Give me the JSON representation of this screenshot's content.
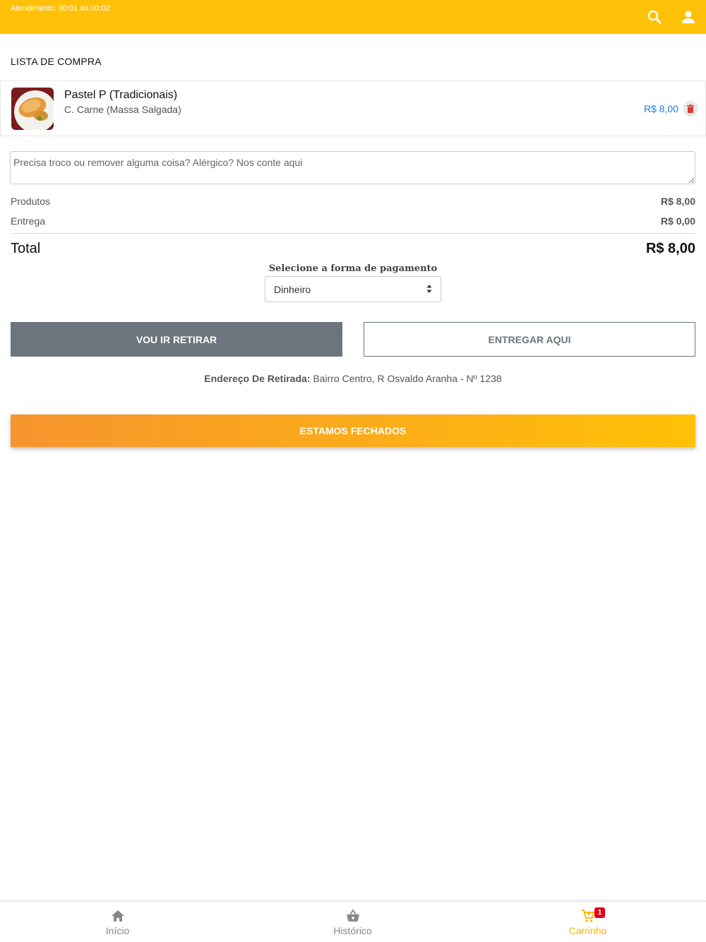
{
  "header": {
    "hours_text": "Atendimento: 00:01 às 00:02",
    "search_icon": "search-icon",
    "user_icon": "user-icon",
    "bg_color": "#ffc107"
  },
  "cart": {
    "title": "LISTA DE COMPRA",
    "items": [
      {
        "name": "Pastel P (Tradicionais)",
        "description": "C. Carne (Massa Salgada)",
        "price": "R$ 8,00"
      }
    ]
  },
  "notes": {
    "placeholder": "Precisa troco ou remover alguma coisa? Alérgico? Nos conte aqui",
    "value": ""
  },
  "summary": {
    "products_label": "Produtos",
    "products_value": "R$ 8,00",
    "delivery_label": "Entrega",
    "delivery_value": "R$ 0,00",
    "total_label": "Total",
    "total_value": "R$ 8,00"
  },
  "payment": {
    "label": "Selecione a forma de pagamento",
    "selected": "Dinheiro"
  },
  "delivery_options": {
    "pickup_label": "VOU IR RETIRAR",
    "deliver_label": "ENTREGAR AQUI"
  },
  "address": {
    "label": "Endereço De Retirada:",
    "value": "Bairro Centro, R Osvaldo Aranha - Nº 1238"
  },
  "checkout": {
    "label": "ESTAMOS FECHADOS",
    "gradient_start": "#f7942e",
    "gradient_end": "#ffc107"
  },
  "bottom_nav": {
    "items": [
      {
        "label": "Início",
        "icon": "home-icon"
      },
      {
        "label": "Histórico",
        "icon": "basket-icon"
      },
      {
        "label": "Carrinho",
        "icon": "cart-icon",
        "badge": "1",
        "active": true
      }
    ]
  }
}
